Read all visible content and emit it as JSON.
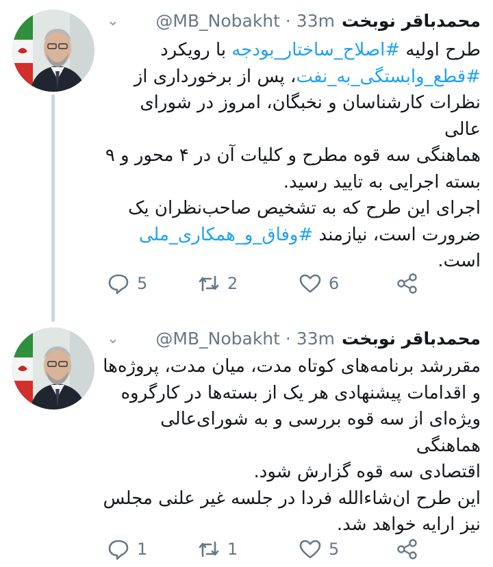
{
  "tweets": [
    {
      "display_name": "محمدباقر نوبخت",
      "handle_time": "@MB_Nobakht · 33m",
      "lines": [
        [
          {
            "t": "طرح اولیه "
          },
          {
            "t": "#اصلاح_ساختار_بودجه",
            "tag": true
          },
          {
            "t": " با رویکرد"
          }
        ],
        [
          {
            "t": "#قطع_وابستگی_به_نفت",
            "tag": true
          },
          {
            "t": "، پس از برخورداری از"
          }
        ],
        [
          {
            "t": "نظرات کارشناسان و نخبگان، امروز در شورای عالی"
          }
        ],
        [
          {
            "t": "هماهنگی سه قوه مطرح و کلیات آن در ۴ محور و ۹"
          }
        ],
        [
          {
            "t": "بسته اجرایی به تایید رسید."
          }
        ],
        [
          {
            "t": "اجرای این طرح که به تشخیص صاحب‌نظران یک"
          }
        ],
        [
          {
            "t": "ضرورت است، نیازمند "
          },
          {
            "t": "#وفاق_و_همکاری_ملی",
            "tag": true
          }
        ],
        [
          {
            "t": "است."
          }
        ]
      ],
      "reply_count": "5",
      "retweet_count": "2",
      "like_count": "6"
    },
    {
      "display_name": "محمدباقر نوبخت",
      "handle_time": "@MB_Nobakht · 33m",
      "lines": [
        [
          {
            "t": "مقررشد برنامه‌های کوتاه مدت، میان مدت، پروژه‌ها"
          }
        ],
        [
          {
            "t": "و اقدامات پیشنهادی هر یک از بسته‌ها در کارگروه"
          }
        ],
        [
          {
            "t": "ویژه‌ای از سه قوه بررسی و به شورای‌عالی هماهنگی"
          }
        ],
        [
          {
            "t": "اقتصادی سه قوه گزارش شود."
          }
        ],
        [
          {
            "t": "این طرح ان‌شاءالله فردا در جلسه غیر علنی مجلس"
          }
        ],
        [
          {
            "t": "نیز ارایه خواهد شد."
          }
        ]
      ],
      "reply_count": "1",
      "retweet_count": "1",
      "like_count": "5"
    }
  ],
  "colors": {
    "hashtag": "#1da1f2",
    "meta": "#657786",
    "thread_line": "#ccd6dd"
  },
  "icons": [
    "caret-down-icon",
    "reply-icon",
    "retweet-icon",
    "like-icon",
    "share-icon"
  ]
}
